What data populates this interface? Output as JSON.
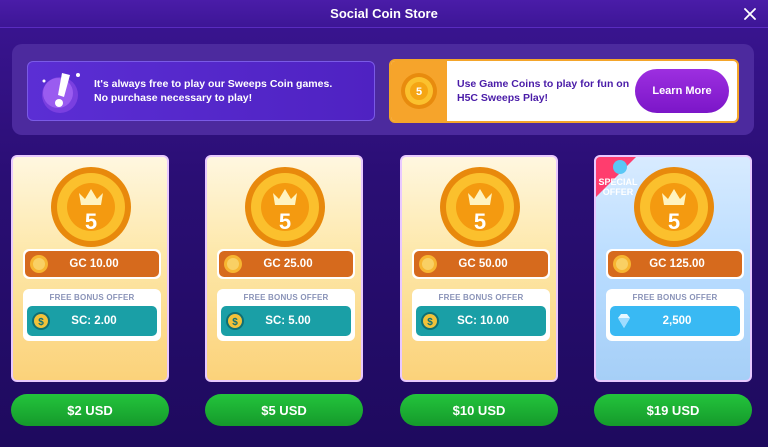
{
  "window": {
    "title": "Social Coin Store"
  },
  "banners": {
    "left": {
      "line1": "It's always free to play our Sweeps Coin games.",
      "line2": "No purchase necessary to play!"
    },
    "right": {
      "text": "Use Game Coins to play for fun on H5C Sweeps Play!",
      "button": "Learn More"
    }
  },
  "bonus_label": "FREE BONUS OFFER",
  "special_badge": {
    "line1": "SPECIAL",
    "line2": "OFFER"
  },
  "cards": [
    {
      "gc": "GC 10.00",
      "bonus": "SC: 2.00",
      "price": "$2 USD",
      "special": false
    },
    {
      "gc": "GC 25.00",
      "bonus": "SC: 5.00",
      "price": "$5 USD",
      "special": false
    },
    {
      "gc": "GC 50.00",
      "bonus": "SC: 10.00",
      "price": "$10 USD",
      "special": false
    },
    {
      "gc": "GC 125.00",
      "bonus": "2,500",
      "price": "$19 USD",
      "special": true
    }
  ],
  "colors": {
    "accent": "#4a1ca8",
    "gc_pill": "#d66a1d",
    "sc_pill": "#1a9fa6",
    "gem_pill": "#39b9f3",
    "buy_button": "#1fb636"
  },
  "icons": {
    "close": "close-icon",
    "coin": "coin-icon",
    "sweeps_coin": "sweeps-coin-icon",
    "gem": "gem-icon",
    "exclamation": "exclamation-icon"
  }
}
